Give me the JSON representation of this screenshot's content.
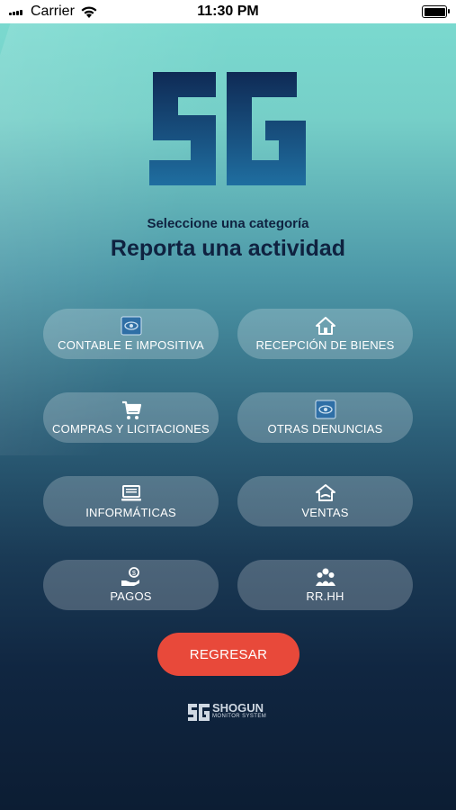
{
  "status_bar": {
    "carrier": "Carrier",
    "time": "11:30 PM"
  },
  "header": {
    "subtitle": "Seleccione una categoría",
    "title": "Reporta una actividad"
  },
  "categories": [
    {
      "label": "CONTABLE E IMPOSITIVA",
      "icon": "tablet-eye-icon"
    },
    {
      "label": "RECEPCIÓN DE BIENES",
      "icon": "home-icon"
    },
    {
      "label": "COMPRAS Y LICITACIONES",
      "icon": "cart-icon"
    },
    {
      "label": "OTRAS DENUNCIAS",
      "icon": "tablet-eye-icon"
    },
    {
      "label": "INFORMÁTICAS",
      "icon": "laptop-icon"
    },
    {
      "label": "VENTAS",
      "icon": "house-hand-icon"
    },
    {
      "label": "PAGOS",
      "icon": "money-hand-icon"
    },
    {
      "label": "RR.HH",
      "icon": "people-icon"
    }
  ],
  "back_button": {
    "label": "REGRESAR"
  },
  "footer": {
    "brand": "SHOGUN",
    "tagline": "MONITOR SYSTEM"
  },
  "colors": {
    "accent": "#e8493a",
    "title": "#0f2240",
    "logo_dark": "#0f2a55",
    "logo_light": "#1f6ea0"
  }
}
